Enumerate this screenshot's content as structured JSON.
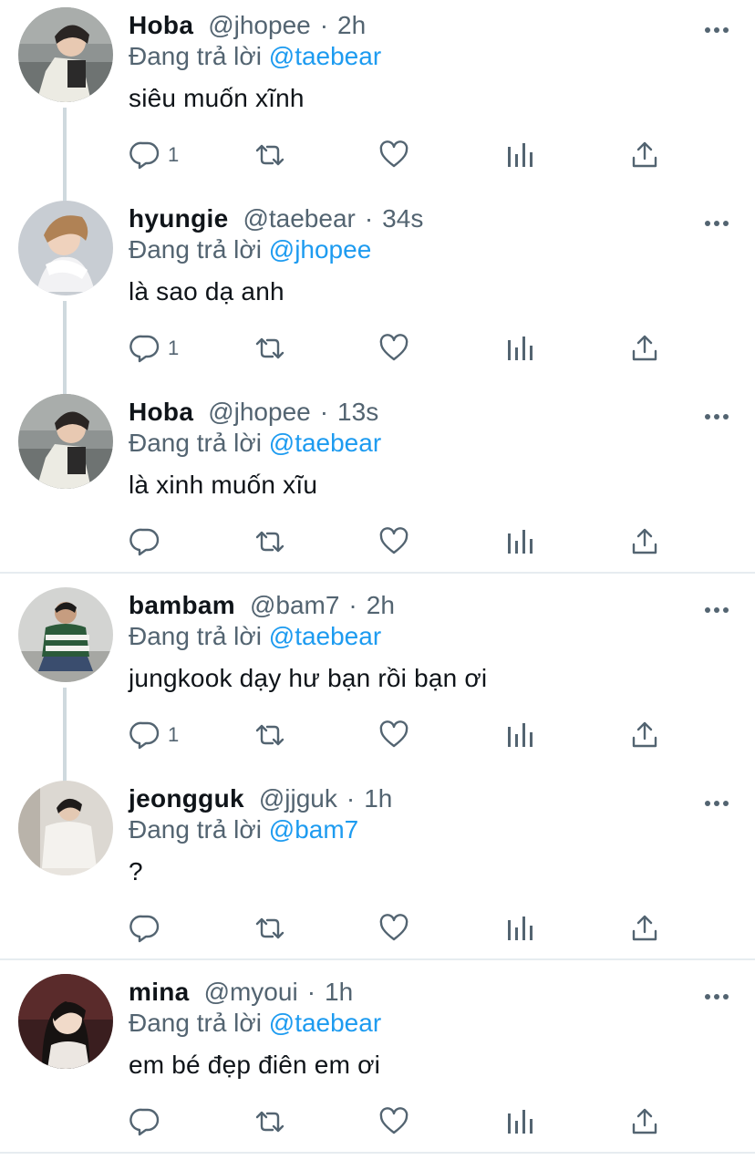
{
  "colors": {
    "accent": "#1d9bf0",
    "secondary_text": "#536471",
    "primary_text": "#0f1419",
    "thread_line": "#cfd9de",
    "divider": "#e6ecf0"
  },
  "icons": [
    "reply-icon",
    "retweet-icon",
    "like-icon",
    "analytics-icon",
    "share-icon",
    "more-icon"
  ],
  "reply_prefix": "Đang trả lời",
  "tweets": [
    {
      "name": "Hoba",
      "handle": "@jhopee",
      "time": "2h",
      "reply_to": "@taebear",
      "text": "siêu muốn xĩnh",
      "reply_count": "1"
    },
    {
      "name": "hyungie",
      "handle": "@taebear",
      "time": "34s",
      "reply_to": "@jhopee",
      "text": "là sao dạ anh",
      "reply_count": "1"
    },
    {
      "name": "Hoba",
      "handle": "@jhopee",
      "time": "13s",
      "reply_to": "@taebear",
      "text": "là xinh muốn xĩu",
      "reply_count": ""
    },
    {
      "name": "bambam",
      "handle": "@bam7",
      "time": "2h",
      "reply_to": "@taebear",
      "text": "jungkook dạy hư bạn rồi bạn ơi",
      "reply_count": "1"
    },
    {
      "name": "jeongguk",
      "handle": "@jjguk",
      "time": "1h",
      "reply_to": "@bam7",
      "text": "?",
      "reply_count": ""
    },
    {
      "name": "mina",
      "handle": "@myoui",
      "time": "1h",
      "reply_to": "@taebear",
      "text": "em bé đẹp điên em ơi",
      "reply_count": ""
    }
  ]
}
